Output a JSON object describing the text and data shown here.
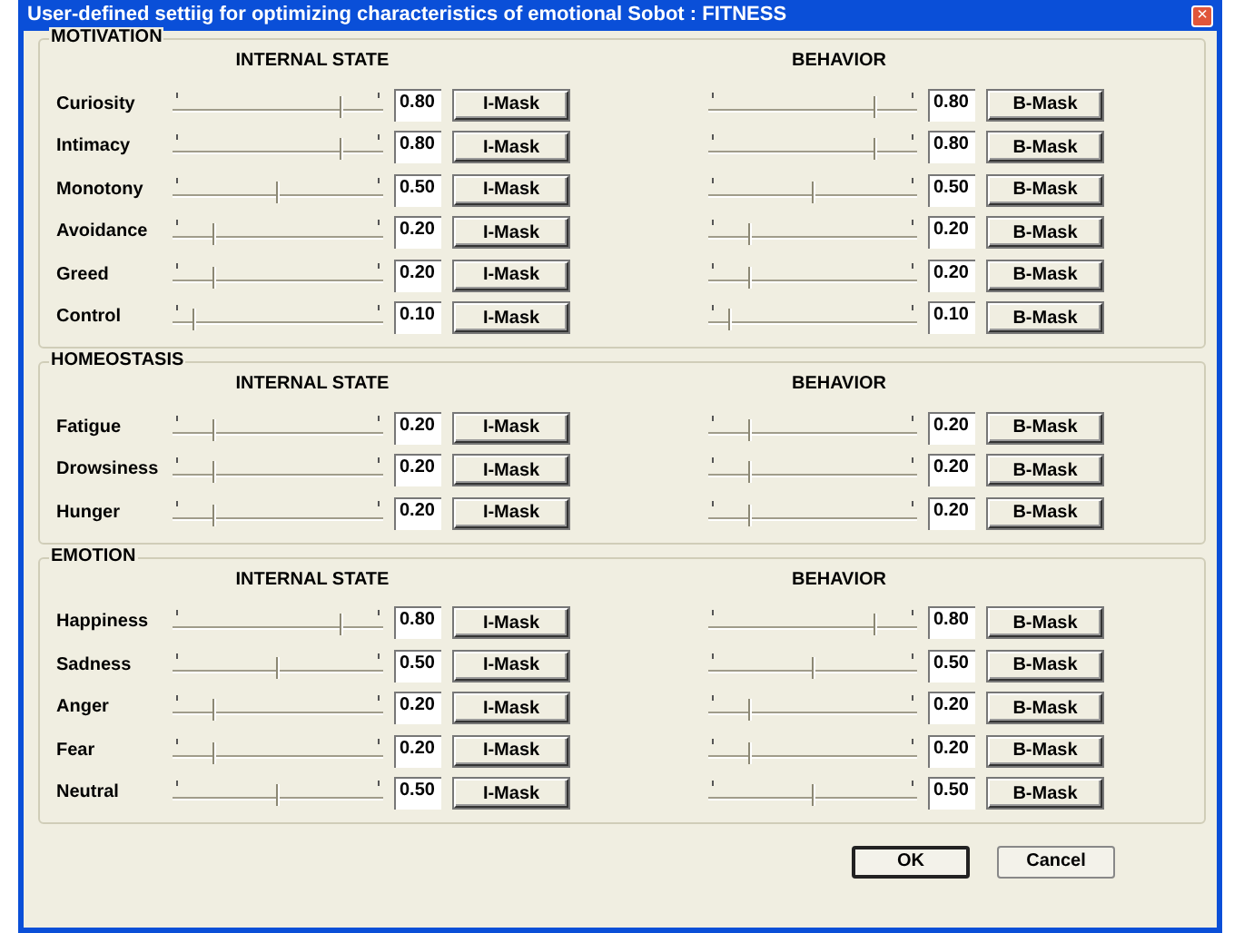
{
  "window": {
    "title": "User-defined settiig for optimizing characteristics of emotional Sobot : FITNESS",
    "close": "×"
  },
  "sections": [
    {
      "title": "MOTIVATION",
      "headers": [
        "INTERNAL STATE",
        "BEHAVIOR"
      ],
      "rows": [
        {
          "label": "Curiosity",
          "internal": {
            "level": 0.8,
            "reading": "0.80",
            "button": "I-Mask"
          },
          "behavior": {
            "level": 0.8,
            "reading": "0.80",
            "button": "B-Mask"
          }
        },
        {
          "label": "Intimacy",
          "internal": {
            "level": 0.8,
            "reading": "0.80",
            "button": "I-Mask"
          },
          "behavior": {
            "level": 0.8,
            "reading": "0.80",
            "button": "B-Mask"
          }
        },
        {
          "label": "Monotony",
          "internal": {
            "level": 0.5,
            "reading": "0.50",
            "button": "I-Mask"
          },
          "behavior": {
            "level": 0.5,
            "reading": "0.50",
            "button": "B-Mask"
          }
        },
        {
          "label": "Avoidance",
          "internal": {
            "level": 0.2,
            "reading": "0.20",
            "button": "I-Mask"
          },
          "behavior": {
            "level": 0.2,
            "reading": "0.20",
            "button": "B-Mask"
          }
        },
        {
          "label": "Greed",
          "internal": {
            "level": 0.2,
            "reading": "0.20",
            "button": "I-Mask"
          },
          "behavior": {
            "level": 0.2,
            "reading": "0.20",
            "button": "B-Mask"
          }
        },
        {
          "label": "Control",
          "internal": {
            "level": 0.1,
            "reading": "0.10",
            "button": "I-Mask"
          },
          "behavior": {
            "level": 0.1,
            "reading": "0.10",
            "button": "B-Mask"
          }
        }
      ]
    },
    {
      "title": "HOMEOSTASIS",
      "headers": [
        "INTERNAL STATE",
        "BEHAVIOR"
      ],
      "rows": [
        {
          "label": "Fatigue",
          "internal": {
            "level": 0.2,
            "reading": "0.20",
            "button": "I-Mask"
          },
          "behavior": {
            "level": 0.2,
            "reading": "0.20",
            "button": "B-Mask"
          }
        },
        {
          "label": "Drowsiness",
          "internal": {
            "level": 0.2,
            "reading": "0.20",
            "button": "I-Mask"
          },
          "behavior": {
            "level": 0.2,
            "reading": "0.20",
            "button": "B-Mask"
          }
        },
        {
          "label": "Hunger",
          "internal": {
            "level": 0.2,
            "reading": "0.20",
            "button": "I-Mask"
          },
          "behavior": {
            "level": 0.2,
            "reading": "0.20",
            "button": "B-Mask"
          }
        }
      ]
    },
    {
      "title": "EMOTION",
      "headers": [
        "INTERNAL STATE",
        "BEHAVIOR"
      ],
      "rows": [
        {
          "label": "Happiness",
          "internal": {
            "level": 0.8,
            "reading": "0.80",
            "button": "I-Mask"
          },
          "behavior": {
            "level": 0.8,
            "reading": "0.80",
            "button": "B-Mask"
          }
        },
        {
          "label": "Sadness",
          "internal": {
            "level": 0.5,
            "reading": "0.50",
            "button": "I-Mask"
          },
          "behavior": {
            "level": 0.5,
            "reading": "0.50",
            "button": "B-Mask"
          }
        },
        {
          "label": "Anger",
          "internal": {
            "level": 0.2,
            "reading": "0.20",
            "button": "I-Mask"
          },
          "behavior": {
            "level": 0.2,
            "reading": "0.20",
            "button": "B-Mask"
          }
        },
        {
          "label": "Fear",
          "internal": {
            "level": 0.2,
            "reading": "0.20",
            "button": "I-Mask"
          },
          "behavior": {
            "level": 0.2,
            "reading": "0.20",
            "button": "B-Mask"
          }
        },
        {
          "label": "Neutral",
          "internal": {
            "level": 0.5,
            "reading": "0.50",
            "button": "I-Mask"
          },
          "behavior": {
            "level": 0.5,
            "reading": "0.50",
            "button": "B-Mask"
          }
        }
      ]
    }
  ],
  "buttons": [
    {
      "label": "OK",
      "default": true
    },
    {
      "label": "Cancel",
      "default": false
    }
  ]
}
